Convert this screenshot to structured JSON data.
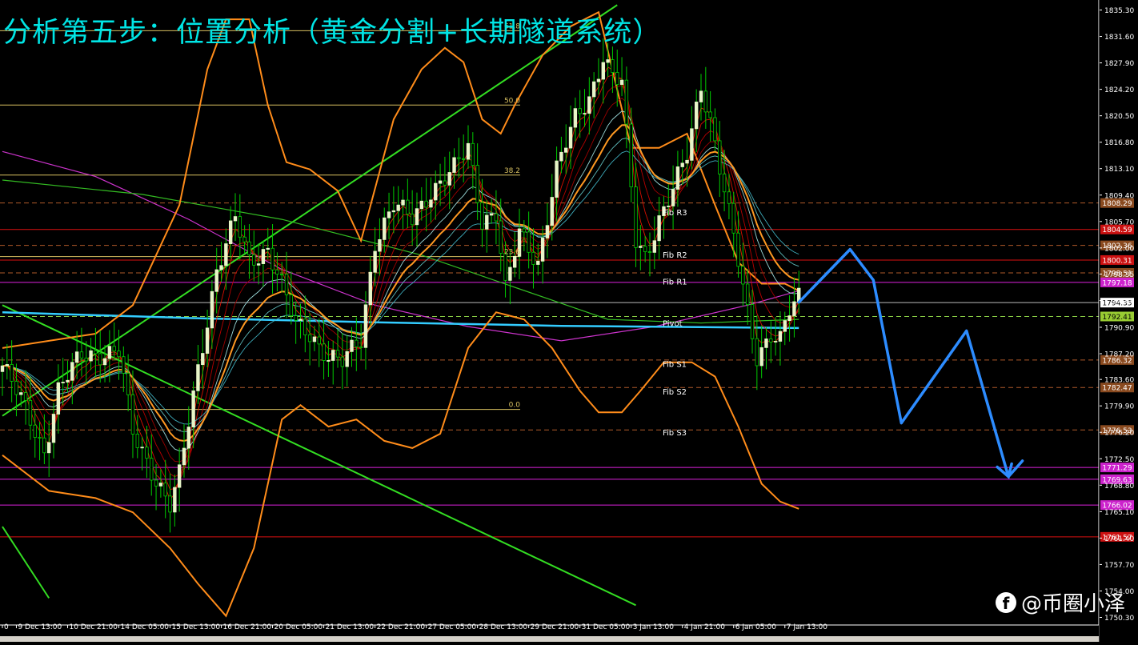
{
  "title": "分析第五步：位置分析（黄金分割+长期隧道系统）",
  "watermark": {
    "icon": "facebook-icon",
    "text": "@币圈小泽"
  },
  "colors": {
    "background": "#000000",
    "bull": "#e8f5c8",
    "bear": "#00cc00",
    "green_trend": "#33dd22",
    "orange_band": "#ff8c1a",
    "magenta": "#cc33cc",
    "cyan": "#33ccff",
    "red_line": "#cc1111",
    "forecast": "#2d8cff"
  },
  "chart_data": {
    "type": "candlestick",
    "ylim": [
      1750.3,
      1835.3
    ],
    "y_ticks": [
      1835.3,
      1831.6,
      1827.9,
      1824.2,
      1820.5,
      1816.8,
      1813.1,
      1809.4,
      1805.7,
      1802.0,
      1798.35,
      1794.65,
      1790.9,
      1787.2,
      1783.6,
      1779.9,
      1776.2,
      1772.5,
      1768.8,
      1765.1,
      1761.4,
      1757.7,
      1754.0,
      1750.3
    ],
    "x_labels": [
      {
        "i": 0,
        "t": "0"
      },
      {
        "i": 3,
        "t": "9 Dec 13:00"
      },
      {
        "i": 14,
        "t": "10 Dec 21:00"
      },
      {
        "i": 25,
        "t": "14 Dec 05:00"
      },
      {
        "i": 36,
        "t": "15 Dec 13:00"
      },
      {
        "i": 47,
        "t": "16 Dec 21:00"
      },
      {
        "i": 58,
        "t": "20 Dec 05:00"
      },
      {
        "i": 69,
        "t": "21 Dec 13:00"
      },
      {
        "i": 80,
        "t": "22 Dec 21:00"
      },
      {
        "i": 91,
        "t": "27 Dec 05:00"
      },
      {
        "i": 102,
        "t": "28 Dec 13:00"
      },
      {
        "i": 113,
        "t": "29 Dec 21:00"
      },
      {
        "i": 124,
        "t": "31 Dec 05:00"
      },
      {
        "i": 135,
        "t": "3 Jan 13:00"
      },
      {
        "i": 146,
        "t": "4 Jan 21:00"
      },
      {
        "i": 157,
        "t": "6 Jan 05:00"
      },
      {
        "i": 168,
        "t": "7 Jan 13:00"
      }
    ],
    "candle_count": 172,
    "close_waypoints": [
      [
        0,
        1785.5
      ],
      [
        5,
        1779.5
      ],
      [
        9,
        1773.5
      ],
      [
        12,
        1782
      ],
      [
        17,
        1787
      ],
      [
        25,
        1787.5
      ],
      [
        28,
        1776
      ],
      [
        32,
        1771
      ],
      [
        36,
        1766
      ],
      [
        38,
        1770
      ],
      [
        42,
        1785
      ],
      [
        46,
        1799
      ],
      [
        50,
        1806
      ],
      [
        53,
        1800
      ],
      [
        57,
        1802
      ],
      [
        60,
        1797
      ],
      [
        63,
        1791
      ],
      [
        66,
        1790
      ],
      [
        70,
        1787
      ],
      [
        73,
        1786
      ],
      [
        77,
        1789
      ],
      [
        80,
        1803
      ],
      [
        84,
        1808
      ],
      [
        88,
        1806
      ],
      [
        92,
        1810
      ],
      [
        97,
        1813
      ],
      [
        100,
        1816
      ],
      [
        103,
        1806
      ],
      [
        106,
        1807
      ],
      [
        108,
        1796
      ],
      [
        111,
        1804
      ],
      [
        115,
        1800
      ],
      [
        119,
        1813
      ],
      [
        123,
        1820
      ],
      [
        126,
        1823
      ],
      [
        129,
        1829
      ],
      [
        131,
        1826
      ],
      [
        133,
        1825
      ],
      [
        136,
        1803
      ],
      [
        138,
        1801
      ],
      [
        141,
        1806
      ],
      [
        144,
        1810
      ],
      [
        147,
        1815
      ],
      [
        150,
        1825
      ],
      [
        152,
        1820
      ],
      [
        155,
        1810
      ],
      [
        158,
        1800
      ],
      [
        160,
        1793
      ],
      [
        162,
        1787
      ],
      [
        165,
        1790
      ],
      [
        167,
        1789
      ],
      [
        169,
        1793
      ],
      [
        171,
        1795
      ]
    ],
    "horizontal_levels": [
      {
        "name": "fib-r3-line",
        "value": 1808.29,
        "color": "#b05a2a",
        "dash": true,
        "badge": "1808.29",
        "badge_color": "#8a4a1f"
      },
      {
        "name": "fib-r3-red-line",
        "value": 1804.59,
        "color": "#dd1111",
        "dash": false,
        "badge": "1804.59",
        "badge_color": "#cc1111"
      },
      {
        "name": "fib-r2-line",
        "value": 1802.36,
        "color": "#b05a2a",
        "dash": true,
        "badge": "1802.36",
        "badge_color": "#8a4a1f"
      },
      {
        "name": "fib-r2-red-line",
        "value": 1800.31,
        "color": "#dd1111",
        "dash": false,
        "badge": "1800.31",
        "badge_color": "#cc1111"
      },
      {
        "name": "fib-r1-line",
        "value": 1798.51,
        "color": "#b05a2a",
        "dash": true,
        "badge": "1798.51",
        "badge_color": "#8a4a1f"
      },
      {
        "name": "magenta-level-1",
        "value": 1797.18,
        "color": "#dd22dd",
        "dash": false,
        "badge": "1797.18",
        "badge_color": "#cc22cc"
      },
      {
        "name": "price-line",
        "value": 1794.35,
        "color": "#bbbbbb",
        "dash": false,
        "badge": "1794.35",
        "badge_color": "#ffffff",
        "badge_text": "#000000"
      },
      {
        "name": "pivot-line",
        "value": 1792.41,
        "color": "#88cc44",
        "dash": true,
        "badge": "1792.41",
        "badge_color": "#99cc33",
        "badge_text": "#000000"
      },
      {
        "name": "fib-s1-line",
        "value": 1786.32,
        "color": "#b05a2a",
        "dash": true,
        "badge": "1786.32",
        "badge_color": "#8a4a1f"
      },
      {
        "name": "fib-s2-line",
        "value": 1782.47,
        "color": "#b05a2a",
        "dash": true,
        "badge": "1782.47",
        "badge_color": "#8a4a1f"
      },
      {
        "name": "fib-s3-line",
        "value": 1776.53,
        "color": "#b05a2a",
        "dash": true,
        "badge": "1776.53",
        "badge_color": "#8a4a1f"
      },
      {
        "name": "magenta-level-2",
        "value": 1771.29,
        "color": "#dd22dd",
        "dash": false,
        "badge": "1771.29",
        "badge_color": "#cc22cc"
      },
      {
        "name": "magenta-level-3",
        "value": 1769.63,
        "color": "#dd22dd",
        "dash": false,
        "badge": "1769.63",
        "badge_color": "#cc22cc"
      },
      {
        "name": "magenta-level-4",
        "value": 1766.02,
        "color": "#dd22dd",
        "dash": false,
        "badge": "1766.02",
        "badge_color": "#cc22cc"
      },
      {
        "name": "red-support-line",
        "value": 1761.57,
        "color": "#dd1111",
        "dash": false,
        "badge": "1761.57",
        "badge_color": "#cc1111"
      }
    ],
    "fib_retracement": [
      {
        "label": "61.8",
        "value": 1832.4
      },
      {
        "label": "50.0",
        "value": 1822.0
      },
      {
        "label": "38.2",
        "value": 1812.2
      },
      {
        "label": "23.6",
        "value": 1800.8
      },
      {
        "label": "0.0",
        "value": 1779.4
      }
    ],
    "pivot_labels": [
      {
        "label": "Fib R3",
        "value": 1806.9
      },
      {
        "label": "Fib R2",
        "value": 1801.0
      },
      {
        "label": "Fib R1",
        "value": 1797.2
      },
      {
        "label": "Pivot",
        "value": 1791.4
      },
      {
        "label": "Fib S1",
        "value": 1785.7
      },
      {
        "label": "Fib S2",
        "value": 1781.8
      },
      {
        "label": "Fib S3",
        "value": 1776.1
      }
    ],
    "trendlines": [
      {
        "name": "rising-trendline",
        "from": [
          0,
          1778.5
        ],
        "to": [
          132,
          1836
        ]
      },
      {
        "name": "falling-trendline-1",
        "from": [
          0,
          1794
        ],
        "to": [
          136,
          1752
        ]
      },
      {
        "name": "falling-trendline-2",
        "from": [
          0,
          1763
        ],
        "to": [
          10,
          1753
        ]
      }
    ],
    "cyan_ma": [
      [
        0,
        1793.0
      ],
      [
        40,
        1792.2
      ],
      [
        80,
        1791.6
      ],
      [
        120,
        1791.1
      ],
      [
        171,
        1790.8
      ]
    ],
    "magenta_ma": [
      [
        0,
        1815.5
      ],
      [
        20,
        1812
      ],
      [
        40,
        1806
      ],
      [
        60,
        1799
      ],
      [
        80,
        1794
      ],
      [
        100,
        1791
      ],
      [
        120,
        1789
      ],
      [
        140,
        1791
      ],
      [
        160,
        1794
      ],
      [
        171,
        1796
      ]
    ],
    "green_ma": [
      [
        0,
        1811.5
      ],
      [
        30,
        1809.5
      ],
      [
        60,
        1806
      ],
      [
        90,
        1801
      ],
      [
        110,
        1796.5
      ],
      [
        130,
        1792
      ],
      [
        150,
        1791.5
      ],
      [
        171,
        1792
      ]
    ],
    "bollinger_upper": [
      [
        0,
        1788
      ],
      [
        10,
        1789
      ],
      [
        20,
        1790
      ],
      [
        28,
        1794
      ],
      [
        38,
        1808
      ],
      [
        44,
        1827
      ],
      [
        48,
        1834
      ],
      [
        53,
        1834
      ],
      [
        57,
        1822
      ],
      [
        61,
        1814
      ],
      [
        66,
        1813
      ],
      [
        72,
        1810
      ],
      [
        77,
        1803
      ],
      [
        84,
        1820
      ],
      [
        90,
        1827
      ],
      [
        95,
        1830
      ],
      [
        99,
        1828
      ],
      [
        103,
        1820
      ],
      [
        107,
        1818
      ],
      [
        110,
        1822
      ],
      [
        116,
        1829
      ],
      [
        122,
        1833
      ],
      [
        128,
        1835
      ],
      [
        135,
        1816
      ],
      [
        141,
        1816
      ],
      [
        147,
        1818
      ],
      [
        153,
        1808
      ],
      [
        158,
        1800
      ],
      [
        163,
        1797
      ],
      [
        168,
        1797
      ],
      [
        171,
        1796
      ]
    ],
    "bollinger_lower": [
      [
        0,
        1773
      ],
      [
        10,
        1768
      ],
      [
        20,
        1767
      ],
      [
        28,
        1765
      ],
      [
        36,
        1760
      ],
      [
        42,
        1755
      ],
      [
        48,
        1750.5
      ],
      [
        54,
        1760
      ],
      [
        60,
        1778
      ],
      [
        64,
        1780
      ],
      [
        70,
        1777
      ],
      [
        76,
        1778
      ],
      [
        82,
        1775
      ],
      [
        88,
        1774
      ],
      [
        94,
        1776
      ],
      [
        100,
        1788
      ],
      [
        106,
        1793
      ],
      [
        112,
        1792
      ],
      [
        118,
        1788
      ],
      [
        124,
        1782
      ],
      [
        128,
        1779
      ],
      [
        133,
        1779
      ],
      [
        137,
        1782
      ],
      [
        142,
        1786
      ],
      [
        148,
        1786
      ],
      [
        153,
        1784
      ],
      [
        158,
        1777
      ],
      [
        163,
        1769
      ],
      [
        167,
        1766.5
      ],
      [
        171,
        1765.5
      ]
    ],
    "ribbon_midline": [
      [
        0,
        1786
      ],
      [
        8,
        1781
      ],
      [
        14,
        1784
      ],
      [
        22,
        1785
      ],
      [
        30,
        1780
      ],
      [
        36,
        1778
      ],
      [
        44,
        1786
      ],
      [
        52,
        1796
      ],
      [
        60,
        1794
      ],
      [
        70,
        1788
      ],
      [
        80,
        1792
      ],
      [
        90,
        1800
      ],
      [
        100,
        1805
      ],
      [
        108,
        1802
      ],
      [
        116,
        1806
      ],
      [
        124,
        1812
      ],
      [
        132,
        1816
      ],
      [
        140,
        1810
      ],
      [
        148,
        1812
      ],
      [
        156,
        1808
      ],
      [
        164,
        1800
      ],
      [
        171,
        1797
      ]
    ],
    "forecast_path": [
      [
        171,
        1794.4
      ],
      [
        182,
        1801.8
      ],
      [
        187,
        1797.5
      ],
      [
        193,
        1777.5
      ],
      [
        207,
        1790.4
      ],
      [
        216,
        1770
      ],
      [
        219,
        1772.2
      ]
    ],
    "candle_step_px": 5.82
  }
}
